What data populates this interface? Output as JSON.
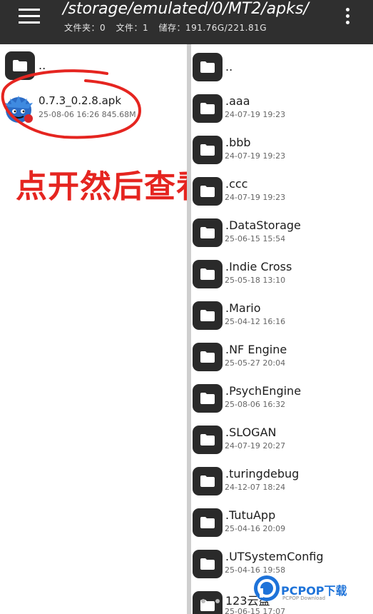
{
  "header": {
    "path": "/storage/emulated/0/MT2/apks/",
    "stats": [
      "文件夹：0",
      "文件：1",
      "储存：191.76G/221.81G"
    ]
  },
  "left_pane": {
    "parent": "..",
    "file": {
      "name": "0.7.3_0.2.8.apk",
      "meta": "25-08-06 16:26 845.68M"
    }
  },
  "annotation": "点开然后查看",
  "right_pane": {
    "parent": "..",
    "items": [
      {
        "name": ".aaa",
        "meta": "24-07-19 19:23"
      },
      {
        "name": ".bbb",
        "meta": "24-07-19 19:23"
      },
      {
        "name": ".ccc",
        "meta": "24-07-19 19:23"
      },
      {
        "name": ".DataStorage",
        "meta": "25-06-15 15:54"
      },
      {
        "name": ".Indie Cross",
        "meta": "25-05-18 13:10"
      },
      {
        "name": ".Mario",
        "meta": "25-04-12 16:16"
      },
      {
        "name": ".NF Engine",
        "meta": "25-05-27 20:04"
      },
      {
        "name": ".PsychEngine",
        "meta": "25-08-06 16:32"
      },
      {
        "name": ".SLOGAN",
        "meta": "24-07-19 20:27"
      },
      {
        "name": ".turingdebug",
        "meta": "24-12-07 18:24"
      },
      {
        "name": ".TutuApp",
        "meta": "25-04-16 20:09"
      },
      {
        "name": ".UTSystemConfig",
        "meta": "25-04-16 19:58"
      },
      {
        "name": "123云盘",
        "meta": "25-06-15 17:07"
      }
    ]
  },
  "watermark": {
    "brand": "PCPOP下载",
    "sub": "PCPOP Download"
  },
  "colors": {
    "toolbar": "#2f2f2f",
    "annotation": "#e52520",
    "watermark": "#1e73d9"
  },
  "icons": [
    "menu-icon",
    "more-vert-icon",
    "folder-icon",
    "apk-app-icon"
  ]
}
